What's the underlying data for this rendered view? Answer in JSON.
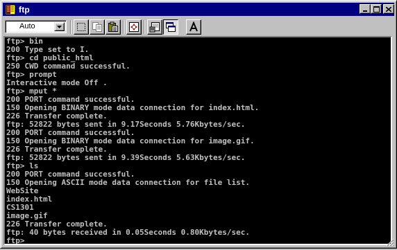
{
  "window": {
    "title": "ftp",
    "accent_color": "#000080"
  },
  "toolbar": {
    "font_size_value": "Auto",
    "tools": [
      {
        "name": "mark-icon"
      },
      {
        "name": "copy-icon"
      },
      {
        "name": "paste-icon"
      },
      {
        "name": "fullscreen-icon"
      },
      {
        "name": "properties-icon"
      },
      {
        "name": "background-icon"
      },
      {
        "name": "font-icon",
        "label": "A"
      }
    ]
  },
  "terminal": {
    "lines": [
      "ftp> bin",
      "200 Type set to I.",
      "ftp> cd public_html",
      "250 CWD command successful.",
      "ftp> prompt",
      "Interactive mode Off .",
      "ftp> mput *",
      "200 PORT command successful.",
      "150 Opening BINARY mode data connection for index.html.",
      "226 Transfer complete.",
      "ftp: 52822 bytes sent in 9.17Seconds 5.76Kbytes/sec.",
      "200 PORT command successful.",
      "150 Opening BINARY mode data connection for image.gif.",
      "226 Transfer complete.",
      "ftp: 52822 bytes sent in 9.39Seconds 5.63Kbytes/sec.",
      "ftp> ls",
      "200 PORT command successful.",
      "150 Opening ASCII mode data connection for file list.",
      "WebSite",
      "index.html",
      "CS1301",
      "image.gif",
      "226 Transfer complete.",
      "ftp: 40 bytes received in 0.05Seconds 0.80Kbytes/sec.",
      "ftp> "
    ]
  }
}
